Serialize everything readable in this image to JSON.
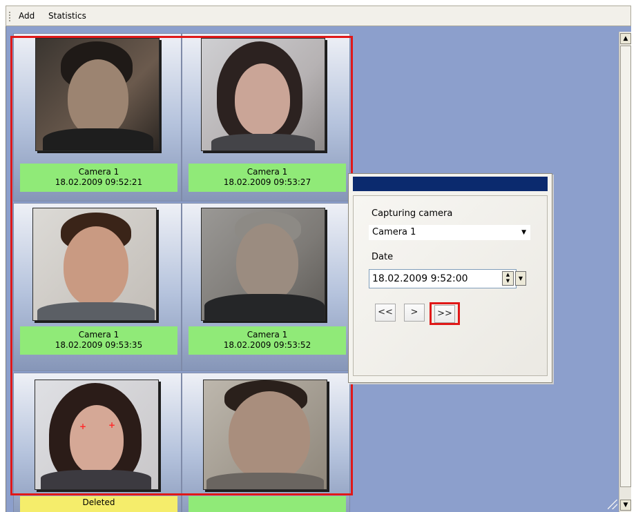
{
  "toolbar": {
    "add_label": "Add",
    "statistics_label": "Statistics"
  },
  "faces": [
    {
      "camera": "Camera 1",
      "timestamp": "18.02.2009 09:52:21",
      "status": "ok"
    },
    {
      "camera": "Camera 1",
      "timestamp": "18.02.2009 09:53:27",
      "status": "ok"
    },
    {
      "camera": "Camera 1",
      "timestamp": "18.02.2009 09:53:35",
      "status": "ok"
    },
    {
      "camera": "Camera 1",
      "timestamp": "18.02.2009 09:53:52",
      "status": "ok"
    },
    {
      "status_text": "Deleted",
      "status": "deleted"
    },
    {
      "status": "ok"
    }
  ],
  "filter_dialog": {
    "camera_label": "Capturing camera",
    "camera_value": "Camera 1",
    "date_label": "Date",
    "date_value": "18.02.2009 9:52:00",
    "nav": {
      "first": "<<",
      "next": ">",
      "last": ">>"
    }
  },
  "colors": {
    "caption_ok": "#90ea78",
    "caption_deleted": "#f5ed6b",
    "highlight": "#e01818",
    "dialog_title": "#0b2a6e",
    "panel_bg": "#8c9fcc"
  },
  "icons": [
    "scroll-up-arrow-icon",
    "scroll-down-arrow-icon",
    "dropdown-arrow-icon",
    "spin-arrows-icon",
    "size-grip-icon"
  ]
}
